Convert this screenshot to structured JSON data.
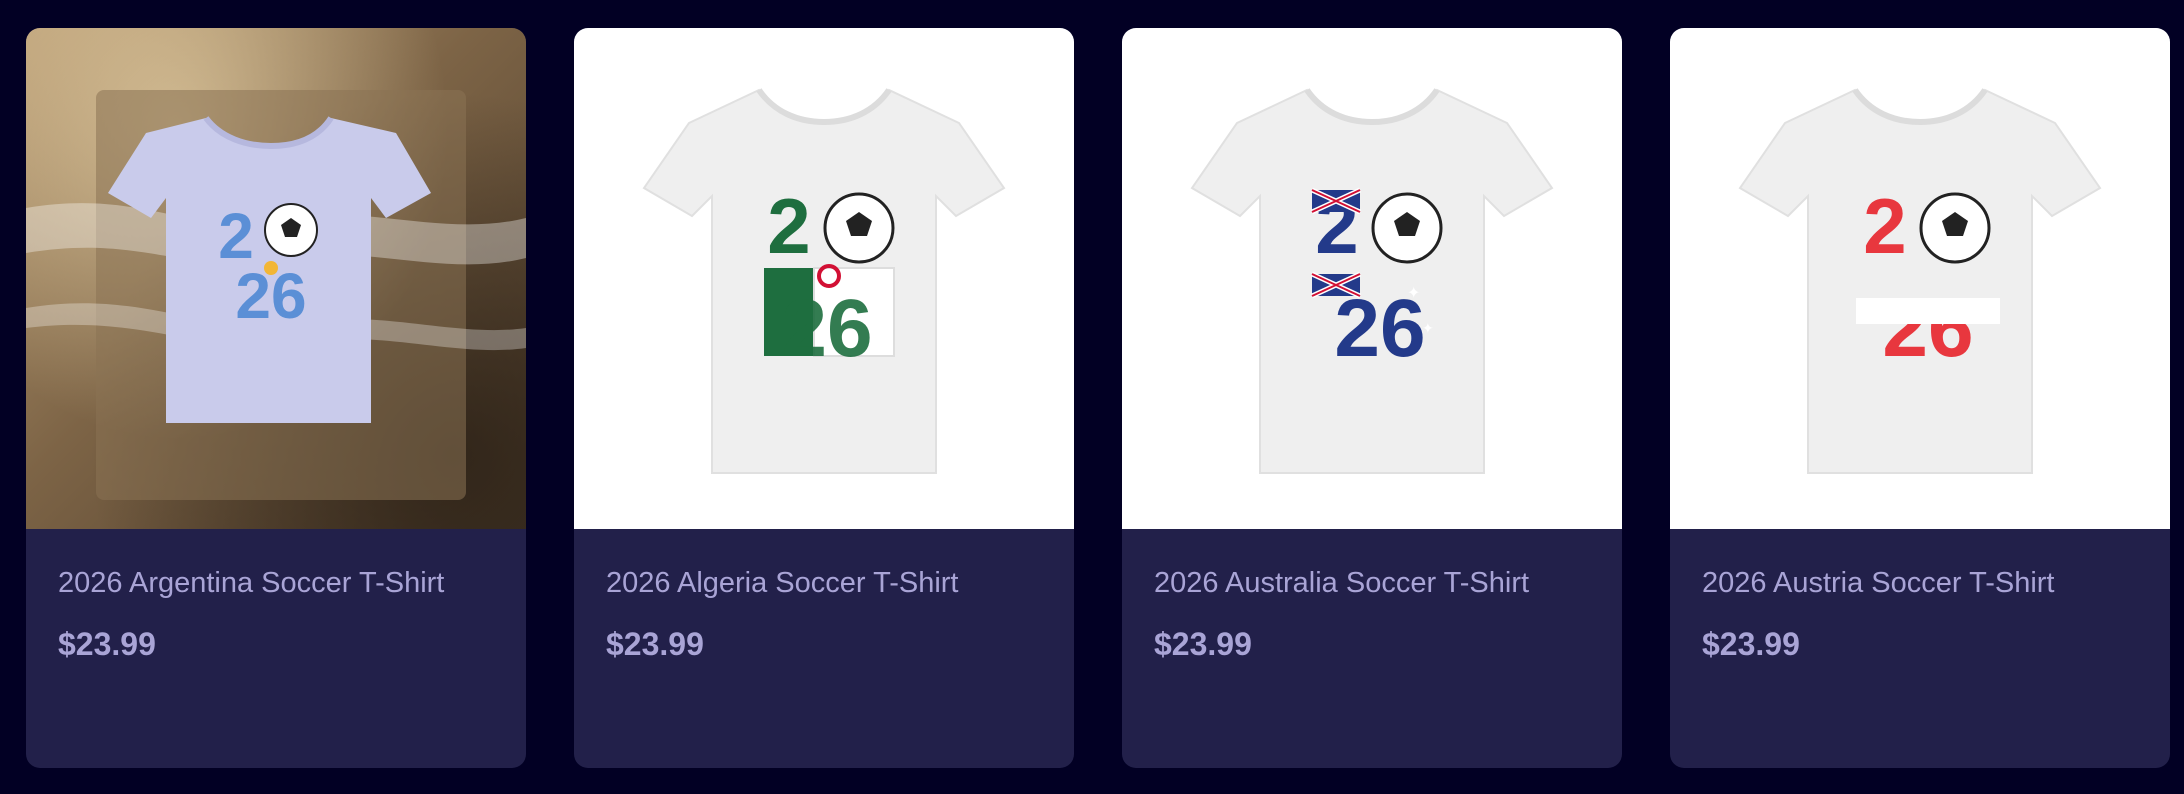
{
  "products": [
    {
      "title": "2026 Argentina Soccer T-Shirt",
      "price": "$23.99",
      "image": "argentina-shirt-on-stone",
      "accent": "#6aa6e0"
    },
    {
      "title": "2026 Algeria Soccer T-Shirt",
      "price": "$23.99",
      "image": "algeria-shirt",
      "accent": "#1f7a45"
    },
    {
      "title": "2026 Australia Soccer T-Shirt",
      "price": "$23.99",
      "image": "australia-shirt",
      "accent": "#233a8a"
    },
    {
      "title": "2026 Austria Soccer T-Shirt",
      "price": "$23.99",
      "image": "austria-shirt",
      "accent": "#e8373e"
    }
  ],
  "colors": {
    "background": "#020024",
    "card": "#22204a",
    "text": "#a9a4d6"
  }
}
